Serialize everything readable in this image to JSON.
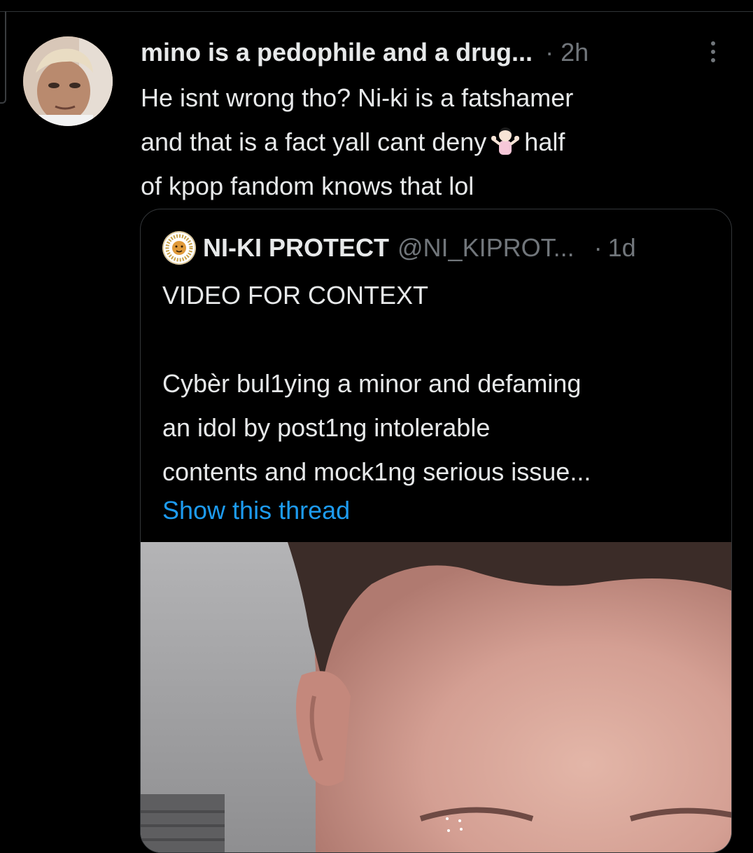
{
  "tweet": {
    "author_name": "mino is a pedophile and a drug...",
    "separator": "·",
    "time": "2h",
    "text_lines": [
      "He isnt wrong tho? Ni-ki is a fatshamer",
      "and that is a fact yall cant deny",
      "half",
      "of kpop fandom knows that lol"
    ],
    "emoji": "person-shrugging-emoji"
  },
  "quoted_tweet": {
    "name": "NI-KI PROTECT",
    "handle": "@NI_KIPROT...",
    "separator": "·",
    "time": "1d",
    "text_lines": [
      "VIDEO FOR CONTEXT",
      "",
      "Cybèr bul1ying a minor  and defaming",
      "an idol by post1ng intolerable",
      "contents and mock1ng serious issue..."
    ],
    "show_thread_label": "Show this thread",
    "avatar_logo": "protection-team-logo-icon"
  },
  "colors": {
    "background": "#000000",
    "text_primary": "#e7e9ea",
    "text_secondary": "#71767b",
    "link": "#1d9bf0",
    "border": "#333639"
  }
}
